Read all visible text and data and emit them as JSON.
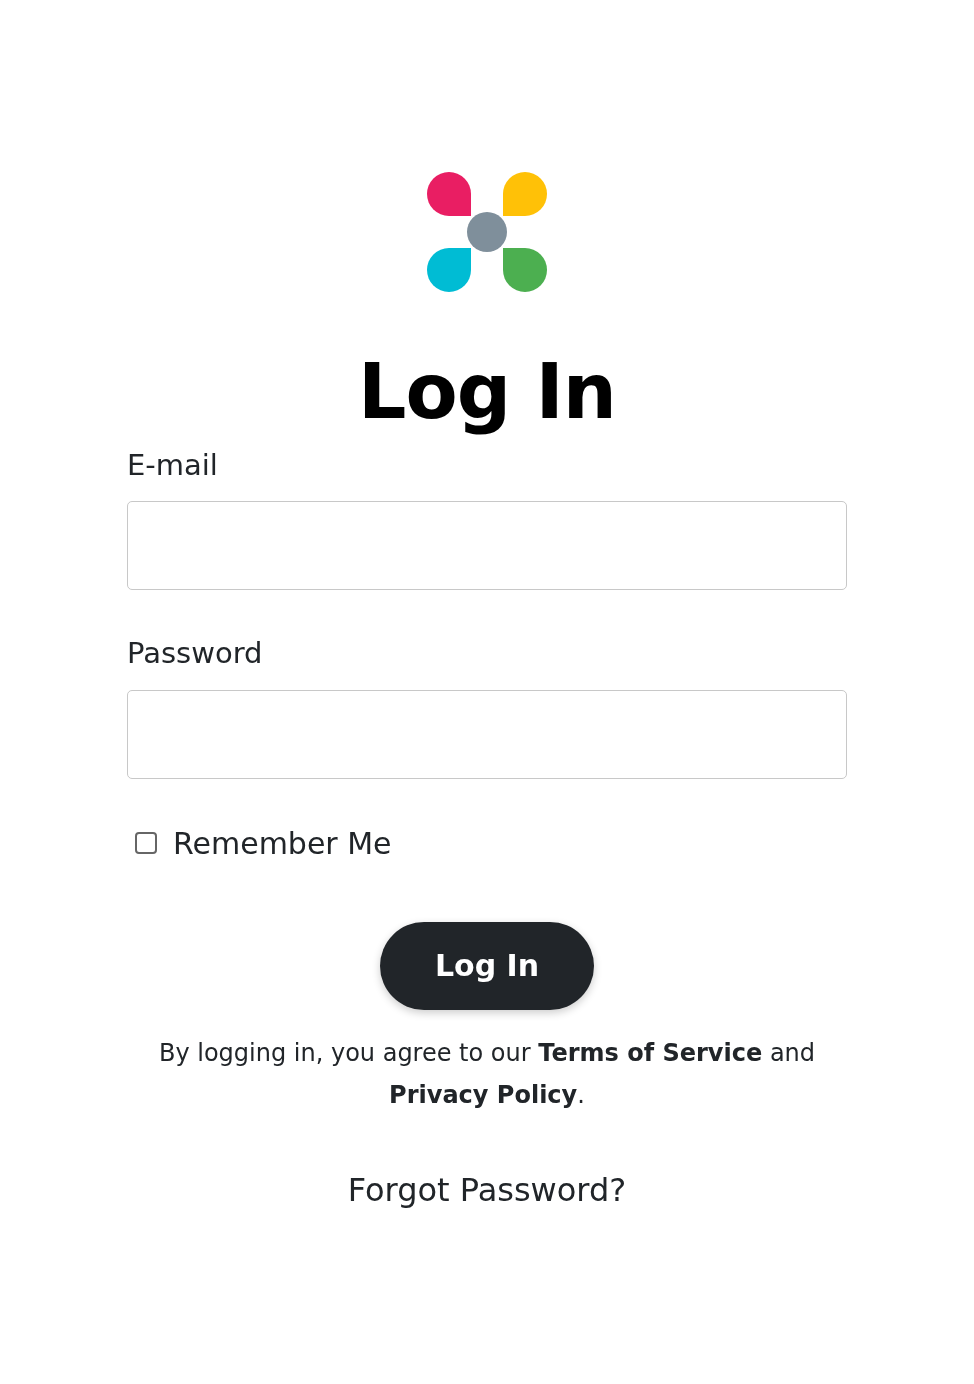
{
  "title": "Log In",
  "fields": [
    {
      "label": "E-mail"
    },
    {
      "label": "Password"
    }
  ],
  "remember": {
    "label": "Remember Me",
    "checked": false
  },
  "button": "Log In",
  "agreement": "By logging in, you agree to our **Terms of Service** and **Privacy Policy**.",
  "forgot": "Forgot Password?"
}
